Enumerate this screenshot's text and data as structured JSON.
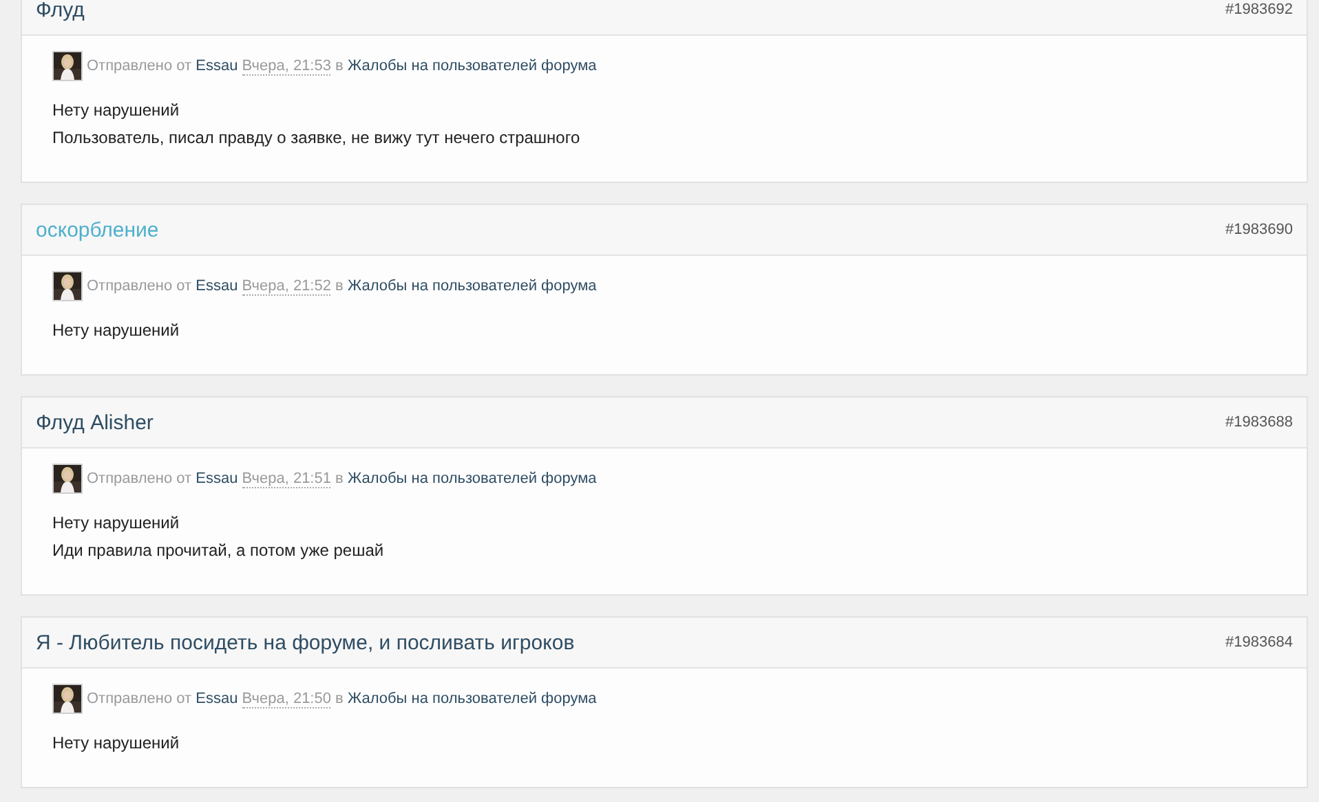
{
  "posts": [
    {
      "title": "Флуд",
      "highlighted": false,
      "number": "#1983692",
      "sent_label": "Отправлено от",
      "author": "Essau",
      "date": "Вчера, 21:53",
      "in_label": "в",
      "forum": "Жалобы на пользователей форума",
      "lines": [
        "Нету нарушений",
        "Пользователь, писал правду о заявке, не вижу тут нечего страшного"
      ]
    },
    {
      "title": "оскорбление",
      "highlighted": true,
      "number": "#1983690",
      "sent_label": "Отправлено от",
      "author": "Essau",
      "date": "Вчера, 21:52",
      "in_label": "в",
      "forum": "Жалобы на пользователей форума",
      "lines": [
        "Нету нарушений"
      ]
    },
    {
      "title": "Флуд Alisher",
      "highlighted": false,
      "number": "#1983688",
      "sent_label": "Отправлено от",
      "author": "Essau",
      "date": "Вчера, 21:51",
      "in_label": "в",
      "forum": "Жалобы на пользователей форума",
      "lines": [
        "Нету нарушений",
        "Иди правила прочитай, а потом уже решай"
      ]
    },
    {
      "title": "Я - Любитель посидеть на форуме, и посливать игроков",
      "highlighted": false,
      "number": "#1983684",
      "sent_label": "Отправлено от",
      "author": "Essau",
      "date": "Вчера, 21:50",
      "in_label": "в",
      "forum": "Жалобы на пользователей форума",
      "lines": [
        "Нету нарушений"
      ]
    }
  ]
}
